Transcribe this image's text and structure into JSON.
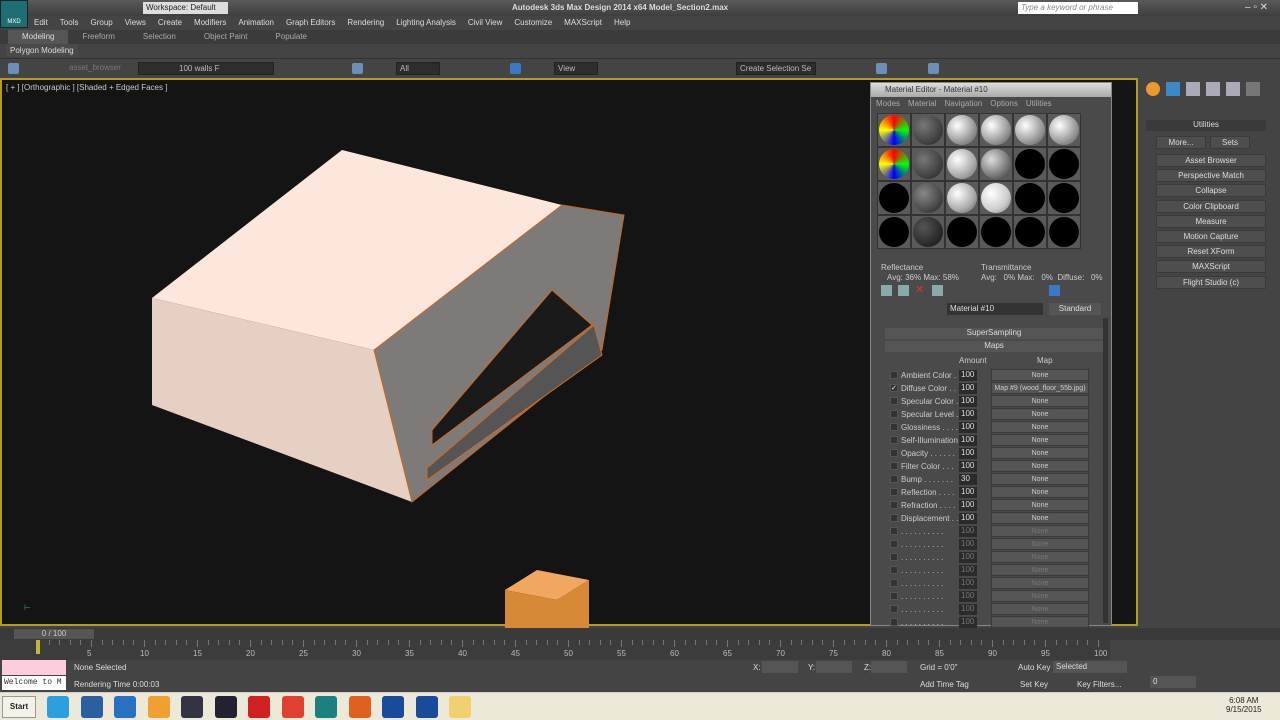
{
  "app": {
    "logo_text": "MXD",
    "workspace": "Workspace: Default",
    "title": "Autodesk 3ds Max Design 2014 x64    Model_Section2.max",
    "search_placeholder": "Type a keyword or phrase"
  },
  "menu": [
    "Edit",
    "Tools",
    "Group",
    "Views",
    "Create",
    "Modifiers",
    "Animation",
    "Graph Editors",
    "Rendering",
    "Lighting Analysis",
    "Civil View",
    "Customize",
    "MAXScript",
    "Help"
  ],
  "ribbon": {
    "tabs": [
      "Modeling",
      "Freeform",
      "Selection",
      "Object Paint",
      "Populate"
    ],
    "active": "Modeling",
    "sub": "Polygon Modeling"
  },
  "toolbar": {
    "layer_label": "asset_browser",
    "layer_dropdown": "100  walls F",
    "filter": "All",
    "ref_coord": "View",
    "selection_set": "Create Selection Se"
  },
  "viewport": {
    "label": "[ + ] [Orthographic ] [Shaded + Edged Faces ]"
  },
  "material_editor": {
    "title": "Material Editor - Material #10",
    "menus": [
      "Modes",
      "Material",
      "Navigation",
      "Options",
      "Utilities"
    ],
    "reflectance_label": "Reflectance",
    "reflectance_value": "Avg:  36% Max:  58%",
    "transmittance_label": "Transmittance",
    "transmittance_value": "Avg:   0% Max:   0%  Diffuse:   0%",
    "material_name": "Material #10",
    "material_type": "Standard",
    "rollout_super": "SuperSampling",
    "rollout_maps": "Maps",
    "col_amount": "Amount",
    "col_map": "Map",
    "maps": [
      {
        "label": "Ambient Color . .",
        "amount": "100",
        "map": "None",
        "checked": false
      },
      {
        "label": "Diffuse Color . .",
        "amount": "100",
        "map": "Map #9 (wood_floor_55b.jpg)",
        "checked": true
      },
      {
        "label": "Specular Color . .",
        "amount": "100",
        "map": "None",
        "checked": false
      },
      {
        "label": "Specular Level . .",
        "amount": "100",
        "map": "None",
        "checked": false
      },
      {
        "label": "Glossiness . . . .",
        "amount": "100",
        "map": "None",
        "checked": false
      },
      {
        "label": "Self-Illumination .",
        "amount": "100",
        "map": "None",
        "checked": false
      },
      {
        "label": "Opacity . . . . . .",
        "amount": "100",
        "map": "None",
        "checked": false
      },
      {
        "label": "Filter Color . . .",
        "amount": "100",
        "map": "None",
        "checked": false
      },
      {
        "label": "Bump . . . . . . .",
        "amount": "30",
        "map": "None",
        "checked": false
      },
      {
        "label": "Reflection . . . .",
        "amount": "100",
        "map": "None",
        "checked": false
      },
      {
        "label": "Refraction . . . .",
        "amount": "100",
        "map": "None",
        "checked": false
      },
      {
        "label": "Displacement . .",
        "amount": "100",
        "map": "None",
        "checked": false
      },
      {
        "label": ". . . . . . . . . .",
        "amount": "100",
        "map": "None",
        "checked": false,
        "dim": true
      },
      {
        "label": ". . . . . . . . . .",
        "amount": "100",
        "map": "None",
        "checked": false,
        "dim": true
      },
      {
        "label": ". . . . . . . . . .",
        "amount": "100",
        "map": "None",
        "checked": false,
        "dim": true
      },
      {
        "label": ". . . . . . . . . .",
        "amount": "100",
        "map": "None",
        "checked": false,
        "dim": true
      },
      {
        "label": ". . . . . . . . . .",
        "amount": "100",
        "map": "None",
        "checked": false,
        "dim": true
      },
      {
        "label": ". . . . . . . . . .",
        "amount": "100",
        "map": "None",
        "checked": false,
        "dim": true
      },
      {
        "label": ". . . . . . . . . .",
        "amount": "100",
        "map": "None",
        "checked": false,
        "dim": true
      },
      {
        "label": ". . . . . . . . . .",
        "amount": "100",
        "map": "None",
        "checked": false,
        "dim": true
      }
    ]
  },
  "utilities": {
    "title": "Utilities",
    "more": "More...",
    "sets": "Sets",
    "items": [
      "Asset Browser",
      "Perspective Match",
      "Collapse",
      "Color Clipboard",
      "Measure",
      "Motion Capture",
      "Reset XForm",
      "MAXScript",
      "Flight Studio (c)"
    ]
  },
  "timeline": {
    "frame": "0 / 100",
    "ticks": [
      "5",
      "10",
      "15",
      "20",
      "25",
      "30",
      "35",
      "40",
      "45",
      "50",
      "55",
      "60",
      "65",
      "70",
      "75",
      "80",
      "85",
      "90",
      "95",
      "100"
    ]
  },
  "status": {
    "selection": "None Selected",
    "render_time": "Rendering Time  0:00:03",
    "maxscript": "Welcome to M",
    "x_label": "X:",
    "y_label": "Y:",
    "z_label": "Z:",
    "grid": "Grid = 0'0\"",
    "add_time_tag": "Add Time Tag",
    "auto_key": "Auto Key",
    "set_key": "Set Key",
    "key_mode": "Selected",
    "key_filters": "Key Filters...",
    "current_frame": "0"
  },
  "taskbar": {
    "start": "Start",
    "time": "6:08 AM",
    "date": "9/15/2015"
  }
}
